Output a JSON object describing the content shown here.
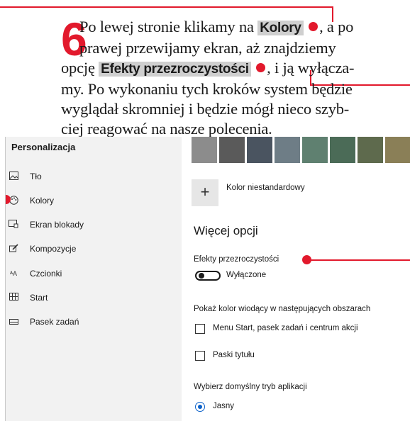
{
  "caption": {
    "step_number": "6",
    "line1_pre": "Po lewej stronie klikamy na",
    "kolory": "Kolory",
    "line1_post": ", a po",
    "line2": "prawej przewijamy ekran, aż znajdziemy",
    "line3_pre": "opcję",
    "efekty": "Efekty przezroczystości",
    "line3_post": ", i ją wyłącza-",
    "line4": "my. Po wykonaniu tych kroków system będzie",
    "line5": "wyglądał skromniej i będzie mógł nieco szyb-",
    "line6": "ciej reagować na nasze polecenia."
  },
  "colors": {
    "accent": "#e2192c",
    "sidebar_bg": "#f2f2f2",
    "highlight_bg": "#cfcfcf",
    "radio_blue": "#0b61c9"
  },
  "sidebar": {
    "title": "Personalizacja",
    "items": [
      {
        "label": "Tło",
        "icon": "image-icon"
      },
      {
        "label": "Kolory",
        "icon": "palette-icon"
      },
      {
        "label": "Ekran blokady",
        "icon": "lock-screen-icon"
      },
      {
        "label": "Kompozycje",
        "icon": "brush-icon"
      },
      {
        "label": "Czcionki",
        "icon": "font-icon"
      },
      {
        "label": "Start",
        "icon": "start-tiles-icon"
      },
      {
        "label": "Pasek zadań",
        "icon": "taskbar-icon"
      }
    ]
  },
  "main": {
    "swatches": [
      "#8c8c8c",
      "#5a5a5a",
      "#4a5460",
      "#6e7d86",
      "#5f8070",
      "#4b6b57",
      "#5e6a4d",
      "#8a7f57"
    ],
    "custom_color_label": "Kolor niestandardowy",
    "more_options_heading": "Więcej opcji",
    "transparency_label": "Efekty przezroczystości",
    "transparency_state": "Wyłączone",
    "show_accent_label": "Pokaż kolor wiodący w następujących obszarach",
    "checkbox_start": "Menu Start, pasek zadań i centrum akcji",
    "checkbox_titlebars": "Paski tytułu",
    "app_mode_label": "Wybierz domyślny tryb aplikacji",
    "app_mode_option": "Jasny"
  }
}
